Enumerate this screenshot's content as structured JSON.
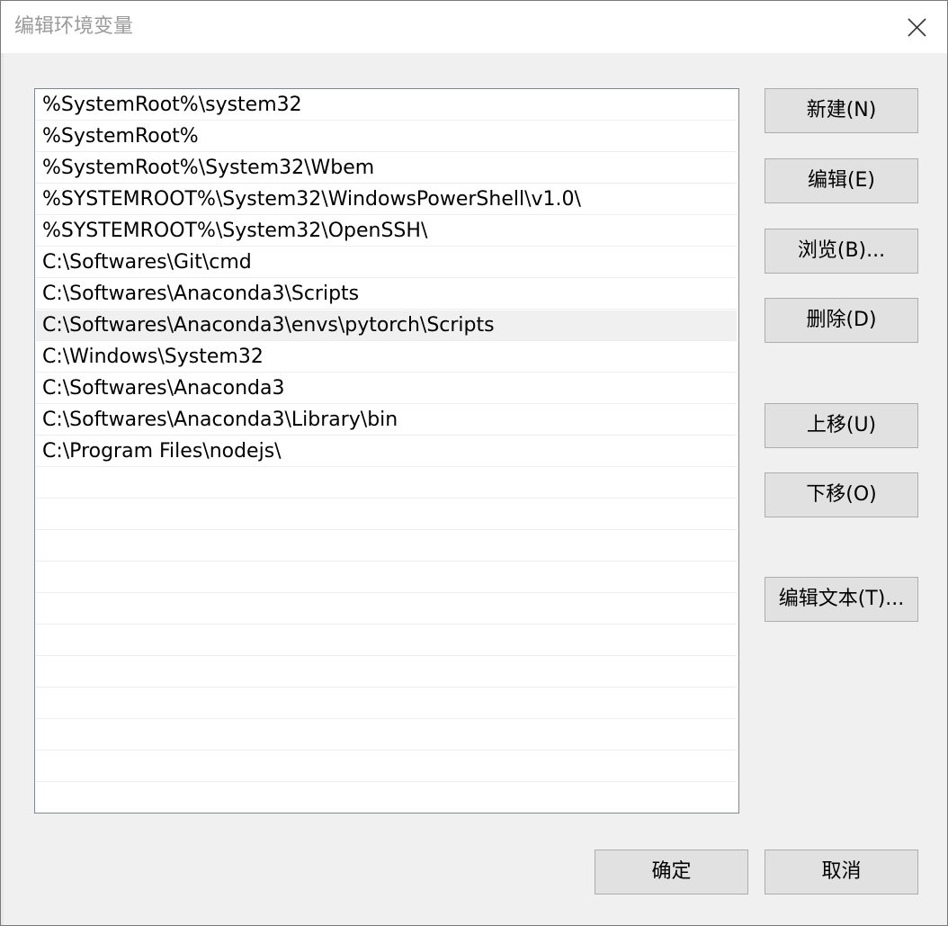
{
  "window": {
    "title": "编辑环境变量"
  },
  "paths": [
    "%SystemRoot%\\system32",
    "%SystemRoot%",
    "%SystemRoot%\\System32\\Wbem",
    "%SYSTEMROOT%\\System32\\WindowsPowerShell\\v1.0\\",
    "%SYSTEMROOT%\\System32\\OpenSSH\\",
    "C:\\Softwares\\Git\\cmd",
    "C:\\Softwares\\Anaconda3\\Scripts",
    "C:\\Softwares\\Anaconda3\\envs\\pytorch\\Scripts",
    "C:\\Windows\\System32",
    "C:\\Softwares\\Anaconda3",
    "C:\\Softwares\\Anaconda3\\Library\\bin",
    "C:\\Program Files\\nodejs\\"
  ],
  "selected_index": 7,
  "buttons": {
    "new": "新建(N)",
    "edit": "编辑(E)",
    "browse": "浏览(B)...",
    "delete": "删除(D)",
    "move_up": "上移(U)",
    "move_down": "下移(O)",
    "edit_text": "编辑文本(T)...",
    "ok": "确定",
    "cancel": "取消"
  },
  "icons": {
    "close": "close-icon"
  }
}
